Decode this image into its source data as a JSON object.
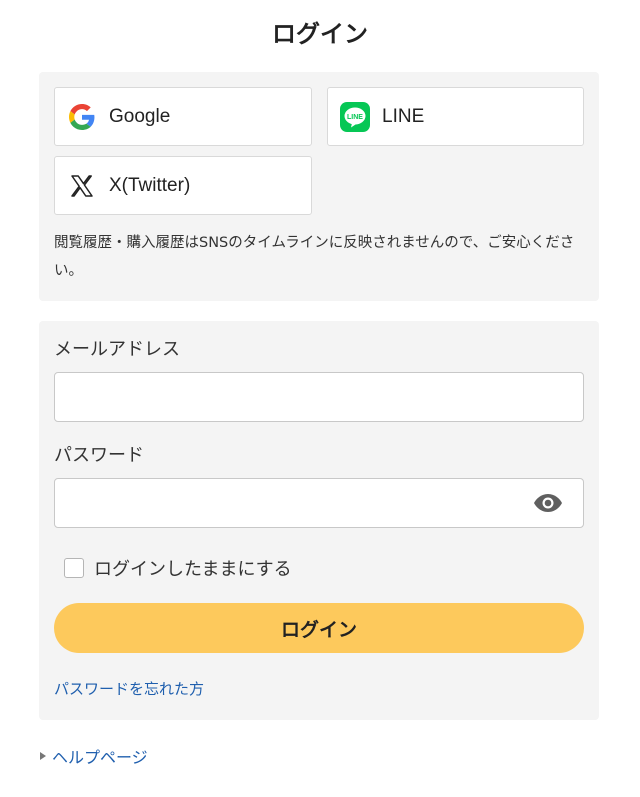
{
  "page": {
    "title": "ログイン"
  },
  "sns": {
    "google_label": "Google",
    "line_label": "LINE",
    "line_icon_text": "LINE",
    "x_label": "X(Twitter)",
    "note": "閲覧履歴・購入履歴はSNSのタイムラインに反映されませんので、ご安心ください。"
  },
  "form": {
    "email_label": "メールアドレス",
    "email_value": "",
    "password_label": "パスワード",
    "password_value": "",
    "remember_label": "ログインしたままにする",
    "remember_checked": false,
    "login_button": "ログイン",
    "forgot_link": "パスワードを忘れた方"
  },
  "footer": {
    "help_link": "ヘルプページ"
  },
  "icons": {
    "google": "google-icon",
    "line": "line-icon",
    "x": "x-icon",
    "eye": "eye-icon",
    "help_arrow": "triangle-right-icon"
  },
  "colors": {
    "panel_bg": "#f4f4f4",
    "login_button_bg": "#fdc95c",
    "link": "#1f5fae",
    "line_green": "#06c755"
  }
}
